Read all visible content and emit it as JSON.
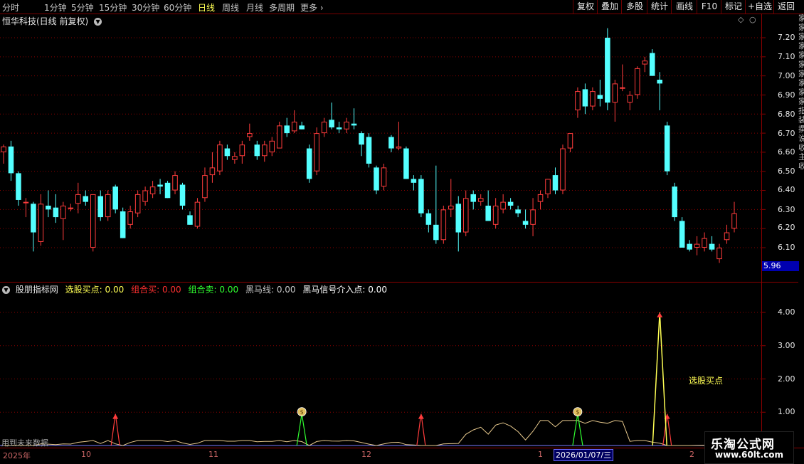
{
  "toolbar": {
    "periods": [
      "分时",
      "1分钟",
      "5分钟",
      "15分钟",
      "30分钟",
      "60分钟",
      "日线",
      "周线",
      "月线",
      "多周期",
      "更多"
    ],
    "active_period": "日线",
    "buttons": [
      "复权",
      "叠加",
      "多股",
      "统计",
      "画线",
      "F10",
      "标记",
      "+自选",
      "返回"
    ]
  },
  "main_chart": {
    "title": "恒华科技(日线 前复权)",
    "current_price_tag": "5.96",
    "y_labels": [
      "7.20",
      "7.10",
      "7.00",
      "6.90",
      "6.80",
      "6.70",
      "6.60",
      "6.50",
      "6.40",
      "6.30",
      "6.20",
      "6.10"
    ]
  },
  "indicator": {
    "name": "股朋指标网",
    "items": [
      {
        "label": "选股买点:",
        "value": "0.00",
        "color": "#ffff54"
      },
      {
        "label": "组合买:",
        "value": "0.00",
        "color": "#ff3030"
      },
      {
        "label": "组合卖:",
        "value": "0.00",
        "color": "#30ff30"
      },
      {
        "label": "黑马线:",
        "value": "0.00",
        "color": "#c8c8c8"
      },
      {
        "label": "黑马信号介入点:",
        "value": "0.00",
        "color": "#ffffff"
      }
    ],
    "y_labels": [
      "4.00",
      "3.00",
      "2.00",
      "1.00"
    ],
    "signal_label": "选股买点"
  },
  "footer": {
    "future_note": "用到未来数据",
    "date_ticks": [
      "2025年",
      "10",
      "11",
      "12",
      "1",
      "2"
    ],
    "cursor_date": "2026/01/07/三"
  },
  "side_strip": [
    "家",
    "家",
    "家",
    "家",
    "家",
    "家",
    "家",
    "家",
    "家",
    "家",
    "指",
    "装",
    "撰",
    "说",
    "收",
    "主",
    "收"
  ],
  "logo": {
    "name": "乐淘公式网",
    "url": "www.60lt.com"
  },
  "colors": {
    "up": "#ff3c3c",
    "down": "#54ffff",
    "ma": "#ffffff",
    "grid": "#8a0000",
    "signal_yellow": "#ffff54"
  },
  "chart_data": {
    "type": "candlestick",
    "ylim": [
      6.02,
      7.28
    ],
    "candles": [
      {
        "o": 6.6,
        "h": 6.64,
        "l": 6.54,
        "c": 6.63
      },
      {
        "o": 6.63,
        "h": 6.66,
        "l": 6.45,
        "c": 6.49
      },
      {
        "o": 6.49,
        "h": 6.5,
        "l": 6.32,
        "c": 6.35
      },
      {
        "o": 6.34,
        "h": 6.36,
        "l": 6.26,
        "c": 6.34
      },
      {
        "o": 6.33,
        "h": 6.34,
        "l": 6.08,
        "c": 6.18
      },
      {
        "o": 6.13,
        "h": 6.38,
        "l": 6.11,
        "c": 6.33
      },
      {
        "o": 6.32,
        "h": 6.4,
        "l": 6.26,
        "c": 6.3
      },
      {
        "o": 6.31,
        "h": 6.38,
        "l": 6.23,
        "c": 6.26
      },
      {
        "o": 6.25,
        "h": 6.34,
        "l": 6.14,
        "c": 6.32
      },
      {
        "o": 6.31,
        "h": 6.33,
        "l": 6.29,
        "c": 6.31
      },
      {
        "o": 6.33,
        "h": 6.44,
        "l": 6.28,
        "c": 6.38
      },
      {
        "o": 6.37,
        "h": 6.4,
        "l": 6.32,
        "c": 6.34
      },
      {
        "o": 6.1,
        "h": 6.38,
        "l": 6.08,
        "c": 6.38
      },
      {
        "o": 6.37,
        "h": 6.4,
        "l": 6.24,
        "c": 6.26
      },
      {
        "o": 6.26,
        "h": 6.4,
        "l": 6.24,
        "c": 6.38
      },
      {
        "o": 6.42,
        "h": 6.43,
        "l": 6.28,
        "c": 6.3
      },
      {
        "o": 6.29,
        "h": 6.31,
        "l": 6.15,
        "c": 6.15
      },
      {
        "o": 6.22,
        "h": 6.32,
        "l": 6.2,
        "c": 6.29
      },
      {
        "o": 6.28,
        "h": 6.4,
        "l": 6.26,
        "c": 6.38
      },
      {
        "o": 6.34,
        "h": 6.42,
        "l": 6.32,
        "c": 6.4
      },
      {
        "o": 6.38,
        "h": 6.45,
        "l": 6.36,
        "c": 6.42
      },
      {
        "o": 6.43,
        "h": 6.46,
        "l": 6.38,
        "c": 6.42
      },
      {
        "o": 6.44,
        "h": 6.45,
        "l": 6.36,
        "c": 6.36
      },
      {
        "o": 6.4,
        "h": 6.5,
        "l": 6.38,
        "c": 6.48
      },
      {
        "o": 6.43,
        "h": 6.44,
        "l": 6.3,
        "c": 6.32
      },
      {
        "o": 6.27,
        "h": 6.29,
        "l": 6.22,
        "c": 6.22
      },
      {
        "o": 6.21,
        "h": 6.36,
        "l": 6.2,
        "c": 6.34
      },
      {
        "o": 6.36,
        "h": 6.52,
        "l": 6.34,
        "c": 6.48
      },
      {
        "o": 6.48,
        "h": 6.6,
        "l": 6.44,
        "c": 6.52
      },
      {
        "o": 6.5,
        "h": 6.66,
        "l": 6.48,
        "c": 6.64
      },
      {
        "o": 6.62,
        "h": 6.64,
        "l": 6.56,
        "c": 6.58
      },
      {
        "o": 6.56,
        "h": 6.6,
        "l": 6.54,
        "c": 6.58
      },
      {
        "o": 6.58,
        "h": 6.66,
        "l": 6.54,
        "c": 6.64
      },
      {
        "o": 6.68,
        "h": 6.75,
        "l": 6.66,
        "c": 6.7
      },
      {
        "o": 6.64,
        "h": 6.66,
        "l": 6.56,
        "c": 6.58
      },
      {
        "o": 6.58,
        "h": 6.66,
        "l": 6.55,
        "c": 6.64
      },
      {
        "o": 6.6,
        "h": 6.68,
        "l": 6.58,
        "c": 6.66
      },
      {
        "o": 6.62,
        "h": 6.76,
        "l": 6.62,
        "c": 6.74
      },
      {
        "o": 6.74,
        "h": 6.78,
        "l": 6.68,
        "c": 6.7
      },
      {
        "o": 6.71,
        "h": 6.82,
        "l": 6.7,
        "c": 6.76
      },
      {
        "o": 6.74,
        "h": 6.76,
        "l": 6.72,
        "c": 6.72
      },
      {
        "o": 6.62,
        "h": 6.64,
        "l": 6.44,
        "c": 6.46
      },
      {
        "o": 6.5,
        "h": 6.73,
        "l": 6.48,
        "c": 6.7
      },
      {
        "o": 6.7,
        "h": 6.78,
        "l": 6.68,
        "c": 6.76
      },
      {
        "o": 6.77,
        "h": 6.86,
        "l": 6.72,
        "c": 6.73
      },
      {
        "o": 6.73,
        "h": 6.76,
        "l": 6.7,
        "c": 6.72
      },
      {
        "o": 6.72,
        "h": 6.78,
        "l": 6.7,
        "c": 6.76
      },
      {
        "o": 6.75,
        "h": 6.83,
        "l": 6.72,
        "c": 6.74
      },
      {
        "o": 6.7,
        "h": 6.71,
        "l": 6.58,
        "c": 6.64
      },
      {
        "o": 6.68,
        "h": 6.7,
        "l": 6.52,
        "c": 6.54
      },
      {
        "o": 6.52,
        "h": 6.53,
        "l": 6.38,
        "c": 6.4
      },
      {
        "o": 6.42,
        "h": 6.54,
        "l": 6.4,
        "c": 6.52
      },
      {
        "o": 6.68,
        "h": 6.69,
        "l": 6.6,
        "c": 6.62
      },
      {
        "o": 6.62,
        "h": 6.76,
        "l": 6.61,
        "c": 6.63
      },
      {
        "o": 6.62,
        "h": 6.63,
        "l": 6.46,
        "c": 6.46
      },
      {
        "o": 6.46,
        "h": 6.48,
        "l": 6.4,
        "c": 6.44
      },
      {
        "o": 6.46,
        "h": 6.48,
        "l": 6.26,
        "c": 6.28
      },
      {
        "o": 6.28,
        "h": 6.3,
        "l": 6.18,
        "c": 6.22
      },
      {
        "o": 6.22,
        "h": 6.53,
        "l": 6.12,
        "c": 6.14
      },
      {
        "o": 6.14,
        "h": 6.32,
        "l": 6.12,
        "c": 6.3
      },
      {
        "o": 6.3,
        "h": 6.46,
        "l": 6.26,
        "c": 6.32
      },
      {
        "o": 6.33,
        "h": 6.37,
        "l": 6.08,
        "c": 6.18
      },
      {
        "o": 6.18,
        "h": 6.4,
        "l": 6.16,
        "c": 6.36
      },
      {
        "o": 6.38,
        "h": 6.4,
        "l": 6.3,
        "c": 6.34
      },
      {
        "o": 6.34,
        "h": 6.38,
        "l": 6.32,
        "c": 6.36
      },
      {
        "o": 6.32,
        "h": 6.4,
        "l": 6.3,
        "c": 6.24
      },
      {
        "o": 6.22,
        "h": 6.36,
        "l": 6.2,
        "c": 6.32
      },
      {
        "o": 6.3,
        "h": 6.38,
        "l": 6.28,
        "c": 6.34
      },
      {
        "o": 6.34,
        "h": 6.36,
        "l": 6.3,
        "c": 6.32
      },
      {
        "o": 6.3,
        "h": 6.32,
        "l": 6.26,
        "c": 6.28
      },
      {
        "o": 6.24,
        "h": 6.3,
        "l": 6.2,
        "c": 6.22
      },
      {
        "o": 6.22,
        "h": 6.36,
        "l": 6.16,
        "c": 6.3
      },
      {
        "o": 6.34,
        "h": 6.4,
        "l": 6.3,
        "c": 6.38
      },
      {
        "o": 6.38,
        "h": 6.46,
        "l": 6.36,
        "c": 6.46
      },
      {
        "o": 6.48,
        "h": 6.52,
        "l": 6.38,
        "c": 6.4
      },
      {
        "o": 6.4,
        "h": 6.64,
        "l": 6.38,
        "c": 6.62
      },
      {
        "o": 6.62,
        "h": 6.7,
        "l": 6.6,
        "c": 6.7
      },
      {
        "o": 6.82,
        "h": 6.94,
        "l": 6.78,
        "c": 6.92
      },
      {
        "o": 6.93,
        "h": 6.96,
        "l": 6.8,
        "c": 6.84
      },
      {
        "o": 6.84,
        "h": 6.94,
        "l": 6.82,
        "c": 6.92
      },
      {
        "o": 6.9,
        "h": 6.98,
        "l": 6.84,
        "c": 6.88
      },
      {
        "o": 7.2,
        "h": 7.25,
        "l": 6.82,
        "c": 6.86
      },
      {
        "o": 6.86,
        "h": 6.98,
        "l": 6.76,
        "c": 6.96
      },
      {
        "o": 6.94,
        "h": 7.06,
        "l": 6.92,
        "c": 6.94
      },
      {
        "o": 6.86,
        "h": 6.92,
        "l": 6.82,
        "c": 6.9
      },
      {
        "o": 6.9,
        "h": 7.05,
        "l": 6.88,
        "c": 7.04
      },
      {
        "o": 7.06,
        "h": 7.1,
        "l": 7.02,
        "c": 7.08
      },
      {
        "o": 7.12,
        "h": 7.14,
        "l": 7.0,
        "c": 7.0
      },
      {
        "o": 6.98,
        "h": 7.02,
        "l": 6.82,
        "c": 6.96
      },
      {
        "o": 6.74,
        "h": 6.76,
        "l": 6.48,
        "c": 6.5
      },
      {
        "o": 6.42,
        "h": 6.44,
        "l": 6.24,
        "c": 6.26
      },
      {
        "o": 6.24,
        "h": 6.26,
        "l": 6.1,
        "c": 6.1
      },
      {
        "o": 6.12,
        "h": 6.14,
        "l": 6.08,
        "c": 6.09
      },
      {
        "o": 6.1,
        "h": 6.16,
        "l": 6.06,
        "c": 6.12
      },
      {
        "o": 6.1,
        "h": 6.18,
        "l": 6.08,
        "c": 6.15
      },
      {
        "o": 6.12,
        "h": 6.16,
        "l": 6.08,
        "c": 6.09
      },
      {
        "o": 6.04,
        "h": 6.12,
        "l": 6.02,
        "c": 6.1
      },
      {
        "o": 6.14,
        "h": 6.22,
        "l": 6.12,
        "c": 6.18
      },
      {
        "o": 6.2,
        "h": 6.34,
        "l": 6.18,
        "c": 6.28
      }
    ],
    "indicator_signal": {
      "ylim": [
        0,
        4.4
      ],
      "buy_point_peak": 4.0,
      "red_arrow_candles": [
        15,
        56,
        89
      ],
      "money_icon_candles": [
        40,
        77
      ]
    }
  }
}
